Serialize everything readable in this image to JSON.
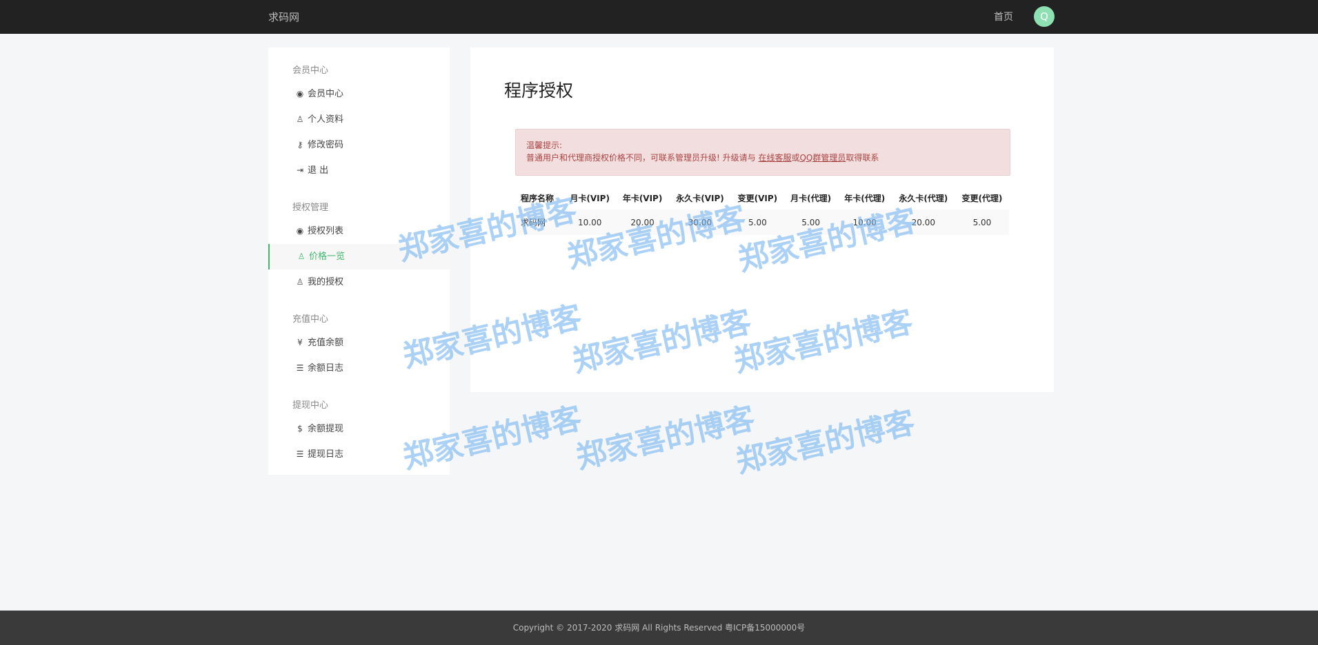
{
  "header": {
    "brand": "求码网",
    "home_link": "首页",
    "avatar_letter": "Q"
  },
  "sidebar": {
    "groups": [
      {
        "title": "会员中心",
        "items": [
          {
            "icon": "user-circle-icon",
            "label": "会员中心"
          },
          {
            "icon": "user-icon",
            "label": "个人资料"
          },
          {
            "icon": "key-icon",
            "label": "修改密码"
          },
          {
            "icon": "sign-out-icon",
            "label": "退 出"
          }
        ]
      },
      {
        "title": "授权管理",
        "items": [
          {
            "icon": "user-circle-icon",
            "label": "授权列表"
          },
          {
            "icon": "user-icon",
            "label": "价格一览",
            "active": true
          },
          {
            "icon": "user-icon",
            "label": "我的授权"
          }
        ]
      },
      {
        "title": "充值中心",
        "items": [
          {
            "icon": "yen-icon",
            "label": "充值余额"
          },
          {
            "icon": "list-icon",
            "label": "余额日志"
          }
        ]
      },
      {
        "title": "提现中心",
        "items": [
          {
            "icon": "dollar-icon",
            "label": "余额提现"
          },
          {
            "icon": "list-icon",
            "label": "提现日志"
          }
        ]
      }
    ]
  },
  "main": {
    "title": "程序授权",
    "alert": {
      "heading": "温馨提示:",
      "text_before": "普通用户和代理商授权价格不同，可联系管理员升级! 升级请与 ",
      "link1": "在线客服",
      "text_mid": "或",
      "link2": "QQ群管理员",
      "text_after": "取得联系"
    },
    "table": {
      "headers": [
        "程序名称",
        "月卡(VIP)",
        "年卡(VIP)",
        "永久卡(VIP)",
        "变更(VIP)",
        "月卡(代理)",
        "年卡(代理)",
        "永久卡(代理)",
        "变更(代理)"
      ],
      "rows": [
        [
          "求码网",
          "10.00",
          "20.00",
          "30.00",
          "5.00",
          "5.00",
          "10.00",
          "20.00",
          "5.00"
        ]
      ]
    }
  },
  "footer": {
    "text": "Copyright © 2017-2020 求码网 All Rights Reserved 粤ICP备15000000号"
  },
  "watermark": {
    "text": "郑家喜的博客"
  }
}
